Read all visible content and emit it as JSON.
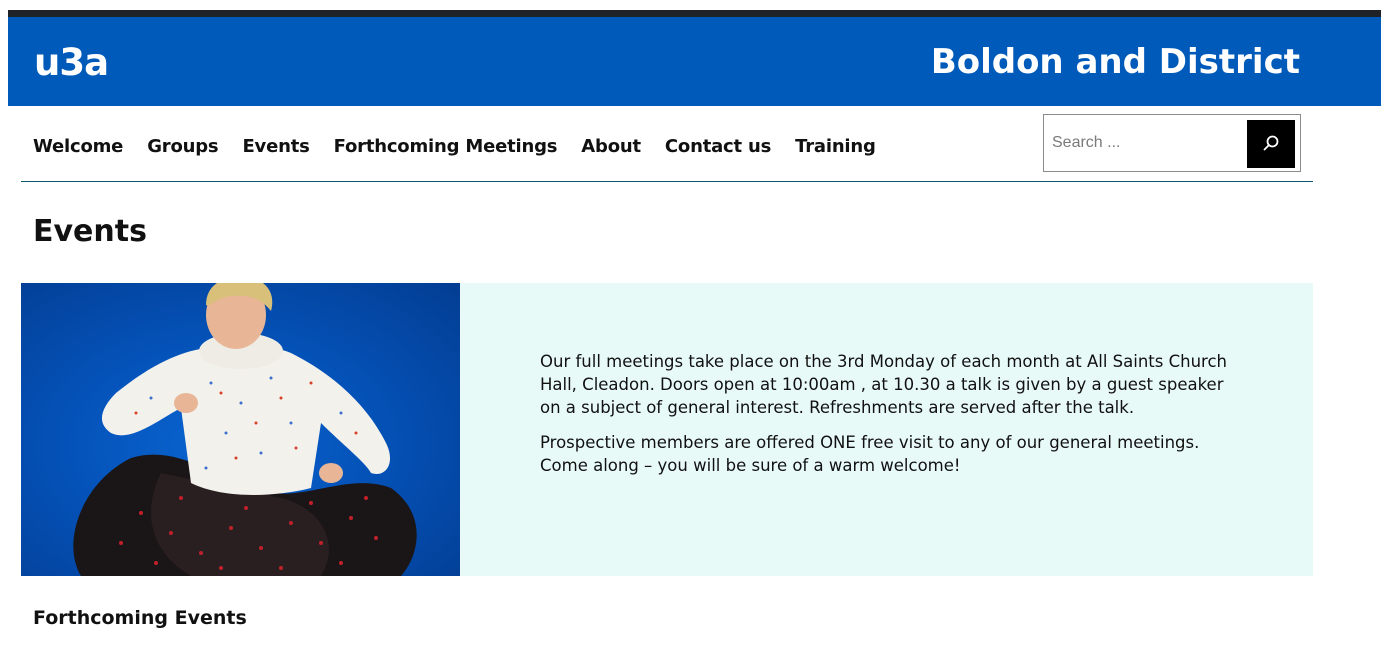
{
  "header": {
    "logo_text": "u3a",
    "site_title": "Boldon and District"
  },
  "nav": {
    "items": [
      {
        "label": "Welcome"
      },
      {
        "label": "Groups"
      },
      {
        "label": "Events"
      },
      {
        "label": "Forthcoming Meetings"
      },
      {
        "label": "About"
      },
      {
        "label": "Contact us"
      },
      {
        "label": "Training"
      }
    ]
  },
  "search": {
    "placeholder": "Search ...",
    "icon": "search-icon"
  },
  "page": {
    "title": "Events"
  },
  "feature": {
    "image": "dancing-woman-photo",
    "paragraphs": [
      "Our full meetings take place on the 3rd Monday of each month at All Saints Church Hall, Cleadon. Doors open at 10:00am , at 10.30 a talk is given by a guest speaker on a subject of general interest. Refreshments are served after the talk.",
      "Prospective members are offered ONE free visit to any of our general meetings. Come along – you will be sure of a warm welcome!"
    ]
  },
  "section": {
    "heading": "Forthcoming Events"
  },
  "colors": {
    "header_bg": "#005ab9",
    "feature_bg": "#e8faf8",
    "search_button": "#000000"
  }
}
